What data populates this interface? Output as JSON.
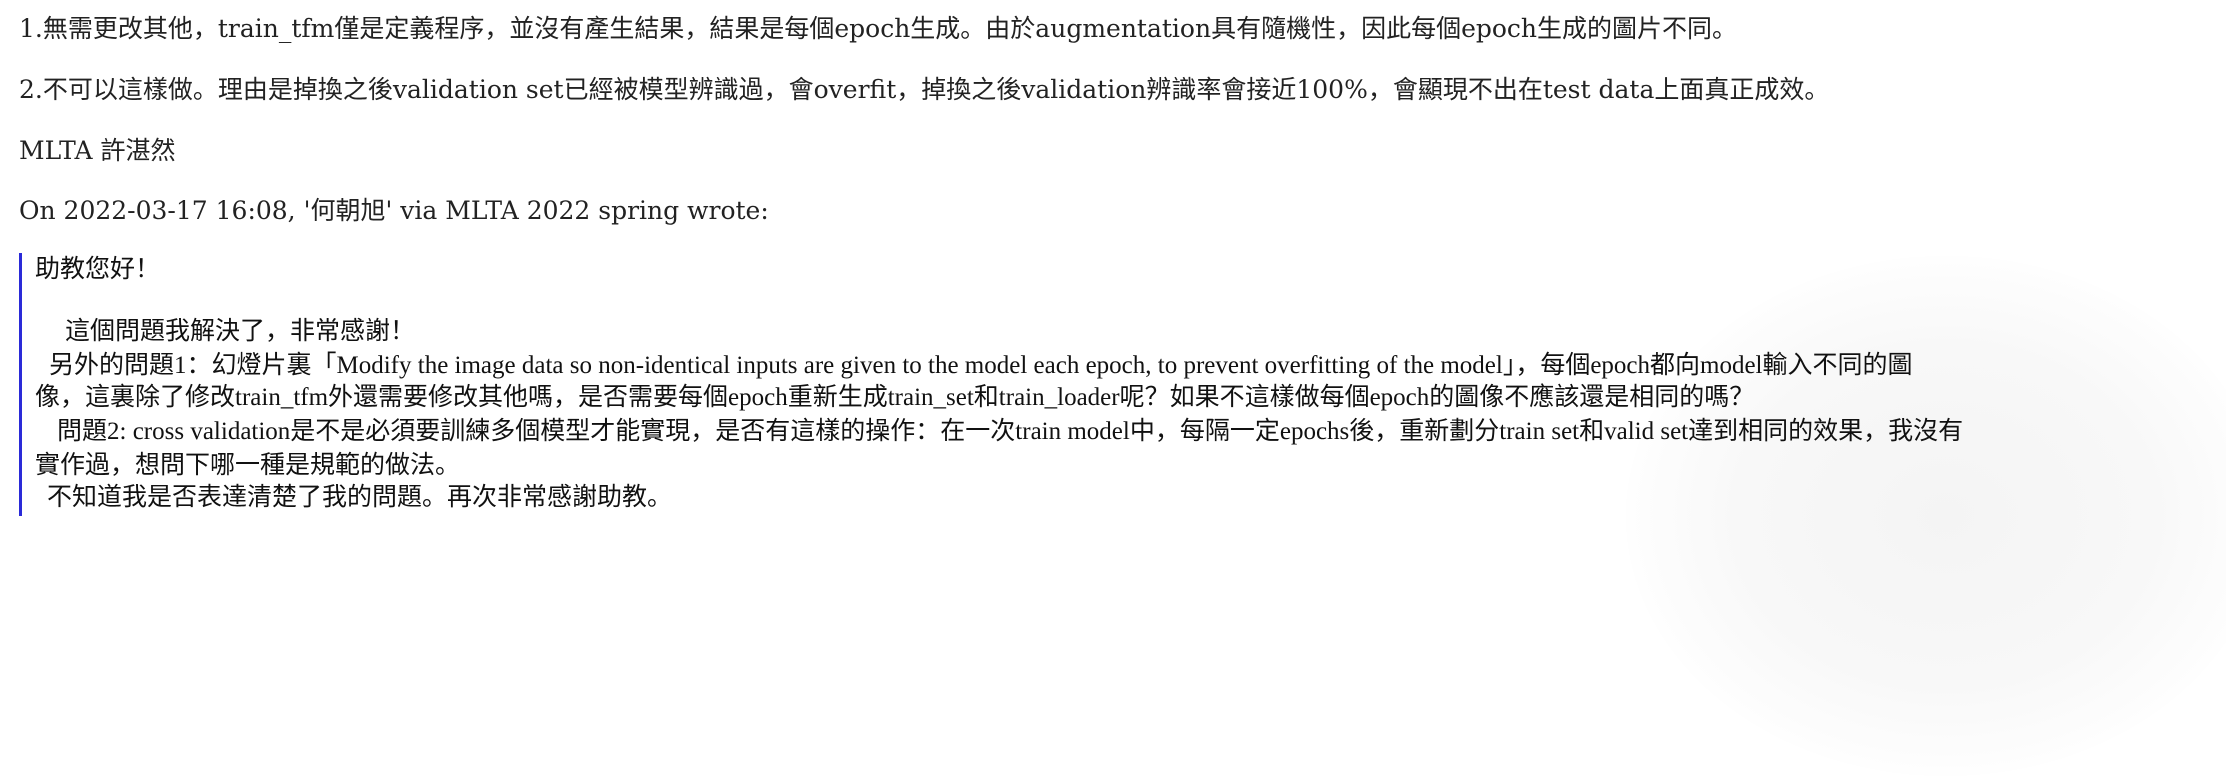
{
  "reply": {
    "line1": "1.無需更改其他，train_tfm僅是定義程序，並沒有產生結果，結果是每個epoch生成。由於augmentation具有隨機性，因此每個epoch生成的圖片不同。",
    "line2": "2.不可以這樣做。理由是掉換之後validation set已經被模型辨識過，會overfit，掉換之後validation辨識率會接近100%，會顯現不出在test data上面真正成效。",
    "signature": "MLTA 許湛然",
    "attribution": "On 2022-03-17 16:08, '何朝旭' via MLTA 2022 spring wrote:"
  },
  "quoted": {
    "greeting": "助教您好！",
    "thanks": "這個問題我解決了，非常感謝！",
    "question1_a": "另外的問題1：幻燈片裏「Modify the image data so non-identical inputs are given to the model each epoch, to prevent overfitting of the model」，每個epoch都向model輸入不同的圖",
    "question1_b": "像，這裏除了修改train_tfm外還需要修改其他嗎，是否需要每個epoch重新生成train_set和train_loader呢？如果不這樣做每個epoch的圖像不應該還是相同的嗎？",
    "question2_a": "問題2: cross validation是不是必須要訓練多個模型才能實現，是否有這樣的操作：在一次train model中，每隔一定epochs後，重新劃分train set和valid set達到相同的效果，我沒有",
    "question2_b": "實作過，想問下哪一種是規範的做法。",
    "closing": "不知道我是否表達清楚了我的問題。再次非常感謝助教。"
  },
  "colors": {
    "quote_bar": "#2a2ad8",
    "text": "#222222",
    "background": "#ffffff"
  }
}
